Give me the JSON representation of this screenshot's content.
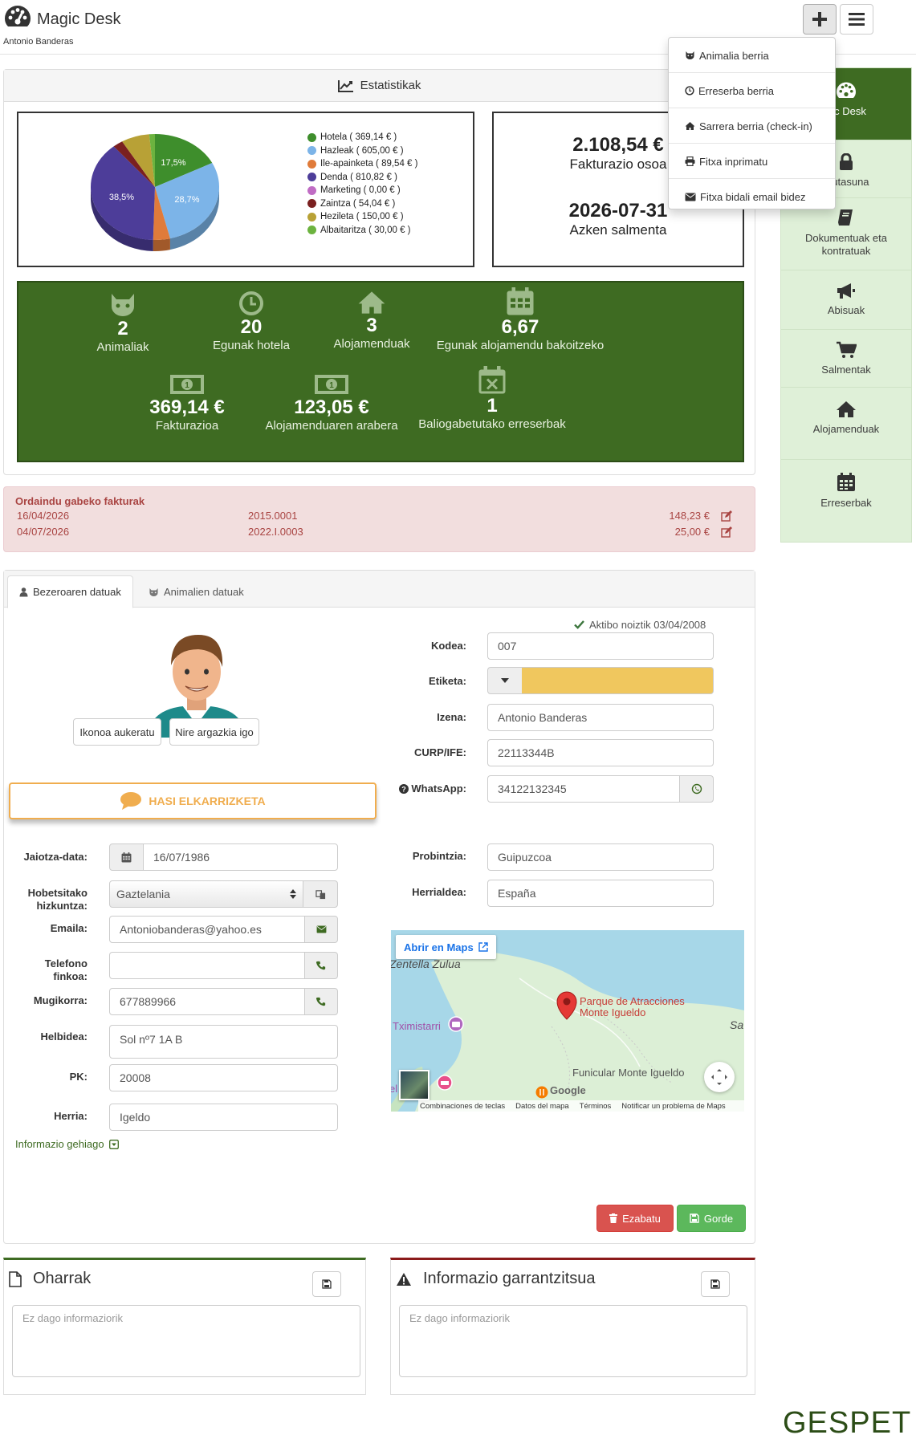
{
  "header": {
    "app_title": "Magic Desk",
    "user_name": "Antonio Banderas"
  },
  "add_menu": {
    "items": [
      {
        "label": "Animalia berria",
        "icon": "cat-icon"
      },
      {
        "label": "Erreserba berria",
        "icon": "clock-icon"
      },
      {
        "label": "Sarrera berria (check-in)",
        "icon": "home-icon"
      },
      {
        "label": "Fitxa inprimatu",
        "icon": "print-icon"
      },
      {
        "label": "Fitxa bidali email bidez",
        "icon": "envelope-icon"
      }
    ]
  },
  "sidebar": {
    "items": [
      {
        "label": "gic Desk",
        "icon": "dashboard-icon"
      },
      {
        "label": "atutasuna",
        "icon": "lock-icon"
      },
      {
        "label": "Dokumentuak eta kontratuak",
        "icon": "book-icon"
      },
      {
        "label": "Abisuak",
        "icon": "bullhorn-icon"
      },
      {
        "label": "Salmentak",
        "icon": "cart-icon"
      },
      {
        "label": "Alojamenduak",
        "icon": "home-icon"
      },
      {
        "label": "Erreserbak",
        "icon": "calendar-icon"
      }
    ]
  },
  "stats": {
    "title": "Estatistikak",
    "total_value": "2.108,54 €",
    "total_label": "Fakturazio osoa",
    "last_sale_value": "2026-07-31",
    "last_sale_label": "Azken salmenta",
    "cards": [
      {
        "value": "2",
        "label": "Animaliak",
        "icon": "cat-icon"
      },
      {
        "value": "20",
        "label": "Egunak hotela",
        "icon": "clock-icon"
      },
      {
        "value": "3",
        "label": "Alojamenduak",
        "icon": "home-icon"
      },
      {
        "value": "6,67",
        "label": "Egunak alojamendu bakoitzeko",
        "icon": "calendar-icon"
      },
      {
        "value": "369,14 €",
        "label": "Fakturazioa",
        "icon": "money-icon"
      },
      {
        "value": "123,05 €",
        "label": "Alojamenduaren arabera",
        "icon": "money-icon"
      },
      {
        "value": "1",
        "label": "Baliogabetutako erreserbak",
        "icon": "calendar-times-icon"
      }
    ]
  },
  "chart_data": {
    "type": "pie",
    "series": [
      {
        "name": "Hotela ( 369,14 € )",
        "value": 369.14,
        "color": "#3e8e2c"
      },
      {
        "name": "Hazleak ( 605,00 € )",
        "value": 605.0,
        "color": "#7cb4e8"
      },
      {
        "name": "Ile-apainketa ( 89,54 € )",
        "value": 89.54,
        "color": "#e07b3a"
      },
      {
        "name": "Denda ( 810,82 € )",
        "value": 810.82,
        "color": "#4d3d99"
      },
      {
        "name": "Marketing ( 0,00 € )",
        "value": 0.0,
        "color": "#c06cc4"
      },
      {
        "name": "Zaintza ( 54,04 € )",
        "value": 54.04,
        "color": "#7a2020"
      },
      {
        "name": "Hezileta ( 150,00 € )",
        "value": 150.0,
        "color": "#b8a136"
      },
      {
        "name": "Albaitaritza ( 30,00 € )",
        "value": 30.0,
        "color": "#6cb33f"
      }
    ],
    "slice_labels": [
      "17,5%",
      "28,7%",
      "38,5%"
    ]
  },
  "unpaid": {
    "title": "Ordaindu gabeko fakturak",
    "rows": [
      {
        "date": "16/04/2026",
        "number": "2015.0001",
        "amount": "148,23 €"
      },
      {
        "date": "04/07/2026",
        "number": "2022.I.0003",
        "amount": "25,00 €"
      }
    ]
  },
  "tabs": [
    {
      "label": "Bezeroaren datuak",
      "icon": "user-icon",
      "active": true
    },
    {
      "label": "Animalien datuak",
      "icon": "cat-icon",
      "active": false
    }
  ],
  "client": {
    "active_since": "Aktibo noiztik 03/04/2008",
    "choose_icon_label": "Ikonoa aukeratu",
    "upload_photo_label": "Nire argazkia igo",
    "chat_label": "HASI ELKARRIZKETA",
    "code_label": "Kodea:",
    "code": "007",
    "tag_label": "Etiketa:",
    "tag_color": "#f0c75e",
    "name_label": "Izena:",
    "name": "Antonio Banderas",
    "curp_label": "CURP/IFE:",
    "curp": "22113344B",
    "whatsapp_label": "WhatsApp:",
    "whatsapp": "34122132345",
    "birth_label": "Jaiotza-data:",
    "birth": "16/07/1986",
    "lang_label": "Hobetsitako hizkuntza:",
    "lang": "Gaztelania",
    "email_label": "Emaila:",
    "email": "Antoniobanderas@yahoo.es",
    "phone_label": "Telefono finkoa:",
    "phone": "",
    "mobile_label": "Mugikorra:",
    "mobile": "677889966",
    "address_label": "Helbidea:",
    "address": "Sol nº7 1A  B",
    "zip_label": "PK:",
    "zip": "20008",
    "city_label": "Herria:",
    "city": "Igeldo",
    "province_label": "Probintzia:",
    "province": "Guipuzcoa",
    "country_label": "Herrialdea:",
    "country": "España",
    "more_info": "Informazio gehiago",
    "delete_label": "Ezabatu",
    "save_label": "Gorde"
  },
  "map": {
    "open_label": "Abrir en Maps",
    "place_main": "Parque de Atracciones",
    "place_main2": "Monte Igueldo",
    "place_top": "Zentella Zulua",
    "place_left": "Tximistarri",
    "place_funicular": "Funicular Monte Igueldo",
    "place_right": "Sa",
    "place_edge": "el",
    "google": "Google",
    "footer": [
      "Combinaciones de teclas",
      "Datos del mapa",
      "Términos",
      "Notificar un problema de Maps"
    ]
  },
  "notes": {
    "title": "Oharrak",
    "placeholder": "Ez dago informaziorik"
  },
  "important": {
    "title": "Informazio garrantzitsua",
    "placeholder": "Ez dago informaziorik"
  },
  "brand": "GESPET"
}
